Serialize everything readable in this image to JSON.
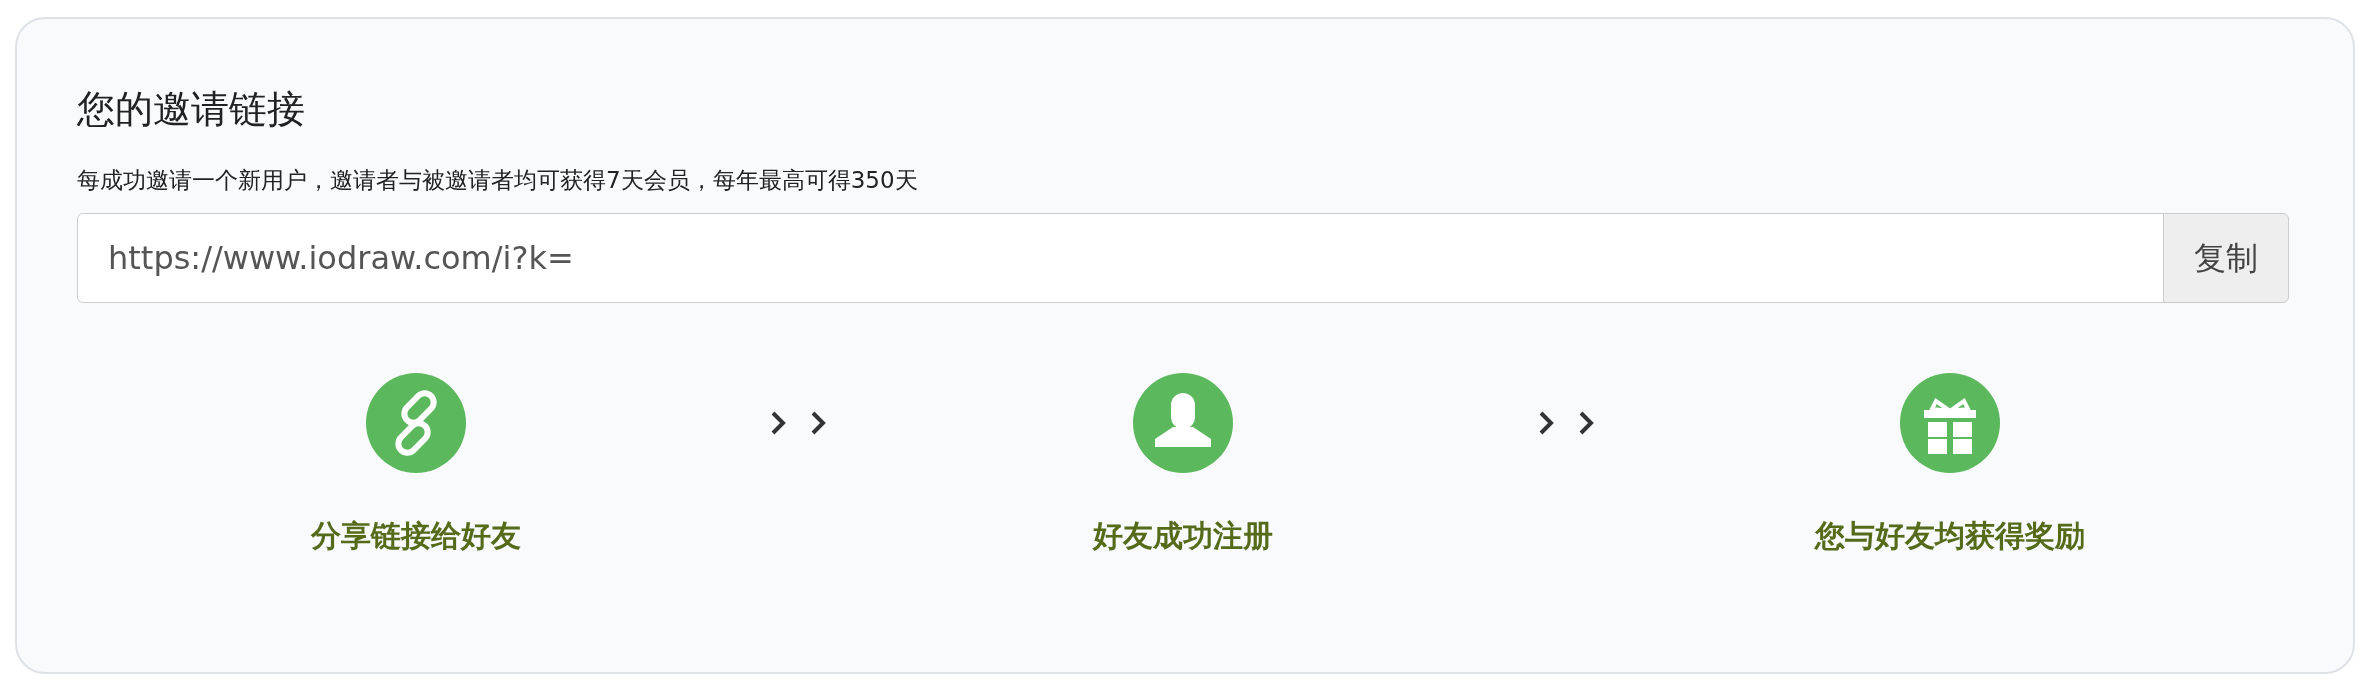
{
  "title": "您的邀请链接",
  "description": "每成功邀请一个新用户，邀请者与被邀请者均可获得7天会员，每年最高可得350天",
  "invite_link": {
    "value": "https://www.iodraw.com/i?k=",
    "button": "复制"
  },
  "steps": [
    {
      "kind": "link",
      "label": "分享链接给好友"
    },
    {
      "kind": "user",
      "label": "好友成功注册"
    },
    {
      "kind": "gift",
      "label": "您与好友均获得奖励"
    }
  ]
}
